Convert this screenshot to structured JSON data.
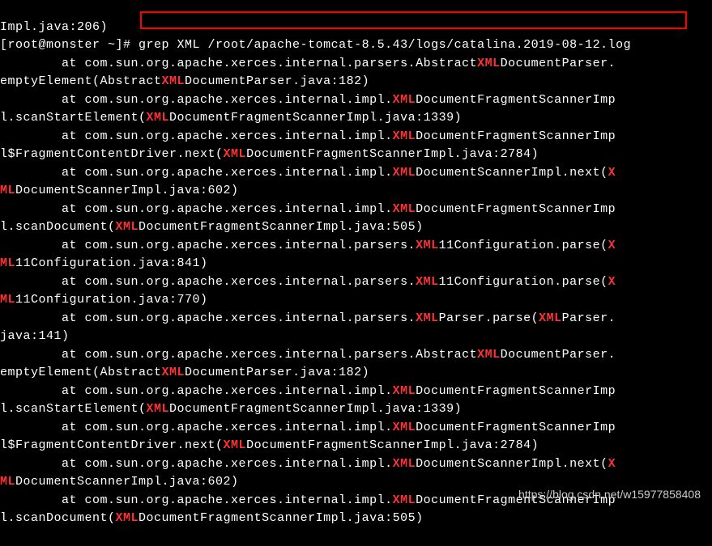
{
  "terminal": {
    "line0": "Impl.java:206)",
    "prompt": "[root@monster ~]# ",
    "command": "grep XML /root/apache-tomcat-8.5.43/logs/catalina.2019-08-12.log",
    "line2_pre": "        at com.sun.org.apache.xerces.internal.parsers.Abstract",
    "line2_post": "DocumentParser.",
    "line3_pre": "emptyElement(Abstract",
    "line3_post": "DocumentParser.java:182)",
    "line4_pre": "        at com.sun.org.apache.xerces.internal.impl.",
    "line4_post": "DocumentFragmentScannerImp",
    "line5_pre": "l.scanStartElement(",
    "line5_post": "DocumentFragmentScannerImpl.java:1339)",
    "line6_pre": "        at com.sun.org.apache.xerces.internal.impl.",
    "line6_post": "DocumentFragmentScannerImp",
    "line7_pre": "l$FragmentContentDriver.next(",
    "line7_post": "DocumentFragmentScannerImpl.java:2784)",
    "line8_pre": "        at com.sun.org.apache.xerces.internal.impl.",
    "line8_post": "DocumentScannerImpl.next(",
    "line9_pre": "ML",
    "line9_post": "DocumentScannerImpl.java:602)",
    "line10_pre": "        at com.sun.org.apache.xerces.internal.impl.",
    "line10_post": "DocumentFragmentScannerImp",
    "line11_pre": "l.scanDocument(",
    "line11_post": "DocumentFragmentScannerImpl.java:505)",
    "line12_pre": "        at com.sun.org.apache.xerces.internal.parsers.",
    "line12_post": "11Configuration.parse(",
    "line13_pre": "ML",
    "line13_post": "11Configuration.java:841)",
    "line14_pre": "        at com.sun.org.apache.xerces.internal.parsers.",
    "line14_post": "11Configuration.parse(",
    "line15_pre": "ML",
    "line15_post": "11Configuration.java:770)",
    "line16_pre": "        at com.sun.org.apache.xerces.internal.parsers.",
    "line16_mid": "Parser.parse(",
    "line16_post": "Parser.",
    "line17": "java:141)",
    "line18_pre": "        at com.sun.org.apache.xerces.internal.parsers.Abstract",
    "line18_post": "DocumentParser.",
    "line19_pre": "emptyElement(Abstract",
    "line19_post": "DocumentParser.java:182)",
    "line20_pre": "        at com.sun.org.apache.xerces.internal.impl.",
    "line20_post": "DocumentFragmentScannerImp",
    "line21_pre": "l.scanStartElement(",
    "line21_post": "DocumentFragmentScannerImpl.java:1339)",
    "line22_pre": "        at com.sun.org.apache.xerces.internal.impl.",
    "line22_post": "DocumentFragmentScannerImp",
    "line23_pre": "l$FragmentContentDriver.next(",
    "line23_post": "DocumentFragmentScannerImpl.java:2784)",
    "line24_pre": "        at com.sun.org.apache.xerces.internal.impl.",
    "line24_post": "DocumentScannerImpl.next(",
    "line25_pre": "ML",
    "line25_post": "DocumentScannerImpl.java:602)",
    "line26_pre": "        at com.sun.org.apache.xerces.internal.impl.",
    "line26_post": "DocumentFragmentScannerImp",
    "line27_pre": "l.scanDocument(",
    "line27_post": "DocumentFragmentScannerImpl.java:505)",
    "xml": "XML",
    "x_char": "X"
  },
  "watermark": "https://blog.csdn.net/w15977858408"
}
